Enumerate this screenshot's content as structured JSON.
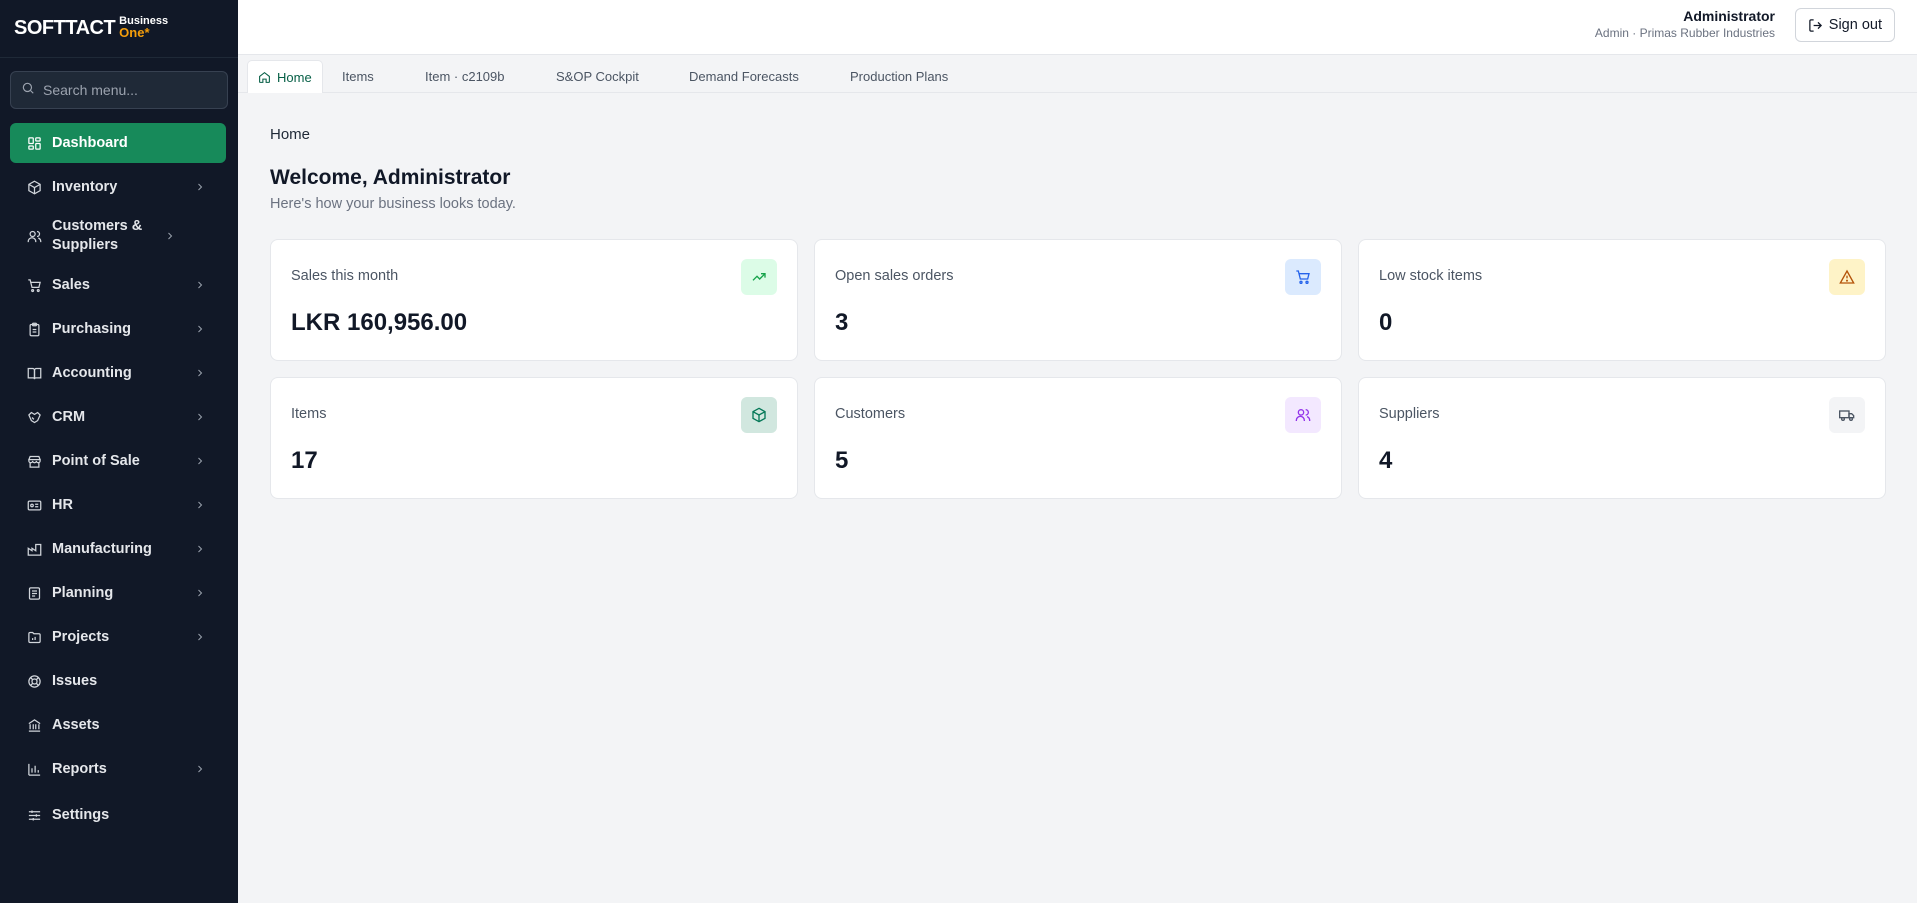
{
  "brand": {
    "main": "SOFTTACT",
    "sub_top": "Business",
    "sub_bottom": "One*"
  },
  "search": {
    "placeholder": "Search menu..."
  },
  "sidebar": {
    "items": [
      {
        "label": "Dashboard",
        "icon": "dashboard-icon",
        "active": true,
        "has_children": false
      },
      {
        "label": "Inventory",
        "icon": "box-icon",
        "has_children": true
      },
      {
        "label": "Customers & Suppliers",
        "icon": "users-icon",
        "has_children": true
      },
      {
        "label": "Sales",
        "icon": "cart-icon",
        "has_children": true
      },
      {
        "label": "Purchasing",
        "icon": "clipboard-icon",
        "has_children": true
      },
      {
        "label": "Accounting",
        "icon": "book-icon",
        "has_children": true
      },
      {
        "label": "CRM",
        "icon": "handshake-icon",
        "has_children": true
      },
      {
        "label": "Point of Sale",
        "icon": "store-icon",
        "has_children": true
      },
      {
        "label": "HR",
        "icon": "id-card-icon",
        "has_children": true
      },
      {
        "label": "Manufacturing",
        "icon": "factory-icon",
        "has_children": true
      },
      {
        "label": "Planning",
        "icon": "planning-icon",
        "has_children": true
      },
      {
        "label": "Projects",
        "icon": "folder-chart-icon",
        "has_children": true
      },
      {
        "label": "Issues",
        "icon": "lifebuoy-icon",
        "has_children": false
      },
      {
        "label": "Assets",
        "icon": "bank-icon",
        "has_children": false
      },
      {
        "label": "Reports",
        "icon": "bar-chart-icon",
        "has_children": true
      },
      {
        "label": "Settings",
        "icon": "sliders-icon",
        "has_children": false
      }
    ]
  },
  "user": {
    "name": "Administrator",
    "role": "Admin · Primas Rubber Industries"
  },
  "signout_label": "Sign out",
  "tabs": [
    {
      "label": "Home",
      "active": true
    },
    {
      "label": "Items"
    },
    {
      "label": "Item · c2109b"
    },
    {
      "label": "S&OP Cockpit"
    },
    {
      "label": "Demand Forecasts"
    },
    {
      "label": "Production Plans"
    }
  ],
  "main": {
    "breadcrumb": "Home",
    "title": "Welcome, Administrator",
    "subtitle": "Here's how your business looks today."
  },
  "cards": [
    {
      "label": "Sales this month",
      "value": "LKR 160,956.00",
      "icon": "trending-up-icon",
      "color": "#16a34a",
      "bg": "#dcfce7"
    },
    {
      "label": "Open sales orders",
      "value": "3",
      "icon": "cart-icon",
      "color": "#2563eb",
      "bg": "#dbeafe"
    },
    {
      "label": "Low stock items",
      "value": "0",
      "icon": "warning-icon",
      "color": "#b45309",
      "bg": "#fef3c7"
    },
    {
      "label": "Items",
      "value": "17",
      "icon": "box-icon",
      "color": "#047857",
      "bg": "#d1e7df"
    },
    {
      "label": "Customers",
      "value": "5",
      "icon": "users-icon",
      "color": "#9333ea",
      "bg": "#f3e8ff"
    },
    {
      "label": "Suppliers",
      "value": "4",
      "icon": "truck-icon",
      "color": "#4b5563",
      "bg": "#f3f4f6"
    }
  ],
  "colors": {
    "accent": "#178a5a",
    "sidebar_bg": "#111827",
    "brand_orange": "#f59e0b"
  }
}
